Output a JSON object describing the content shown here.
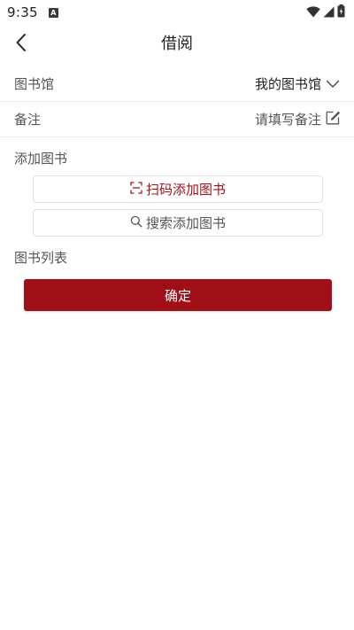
{
  "status_bar": {
    "time": "9:35",
    "notification_icon_letter": "A",
    "icons": [
      "wifi-icon",
      "signal-icon",
      "battery-icon"
    ]
  },
  "header": {
    "title": "借阅",
    "back_icon": "chevron-left-icon"
  },
  "form": {
    "library": {
      "label": "图书馆",
      "value": "我的图书馆",
      "icon": "chevron-down-icon"
    },
    "remark": {
      "label": "备注",
      "placeholder": "请填写备注",
      "icon": "edit-icon"
    }
  },
  "add_books": {
    "section_title": "添加图书",
    "scan_button": "扫码添加图书",
    "scan_icon": "scan-icon",
    "search_button": "搜索添加图书",
    "search_icon": "search-icon"
  },
  "book_list": {
    "section_title": "图书列表"
  },
  "confirm_button": "确定",
  "colors": {
    "accent": "#a00f18",
    "scan_text": "#a3121e",
    "background": "#ffffff",
    "divider": "#ececec"
  }
}
